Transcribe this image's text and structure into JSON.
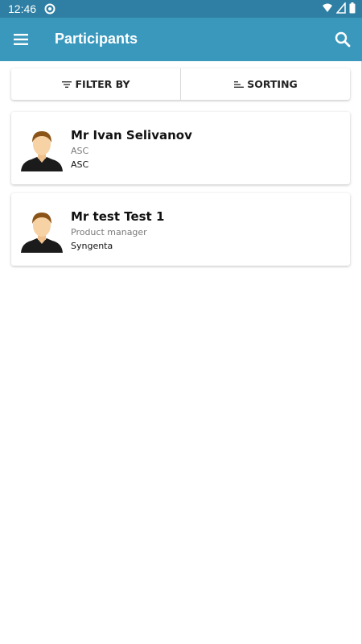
{
  "status": {
    "time": "12:46"
  },
  "appbar": {
    "title": "Participants"
  },
  "controls": {
    "filter_label": "FILTER BY",
    "sorting_label": "SORTING"
  },
  "participants": [
    {
      "name": "Mr Ivan Selivanov",
      "role": "ASC",
      "company": "ASC"
    },
    {
      "name": "Mr test Test 1",
      "role": "Product manager",
      "company": "Syngenta"
    }
  ],
  "colors": {
    "statusbar": "#2e7fa3",
    "appbar": "#3a98bc"
  },
  "icons": [
    "menu-icon",
    "search-icon",
    "filter-icon",
    "sort-icon",
    "wifi-icon",
    "signal-icon",
    "battery-icon",
    "person-avatar-icon"
  ]
}
